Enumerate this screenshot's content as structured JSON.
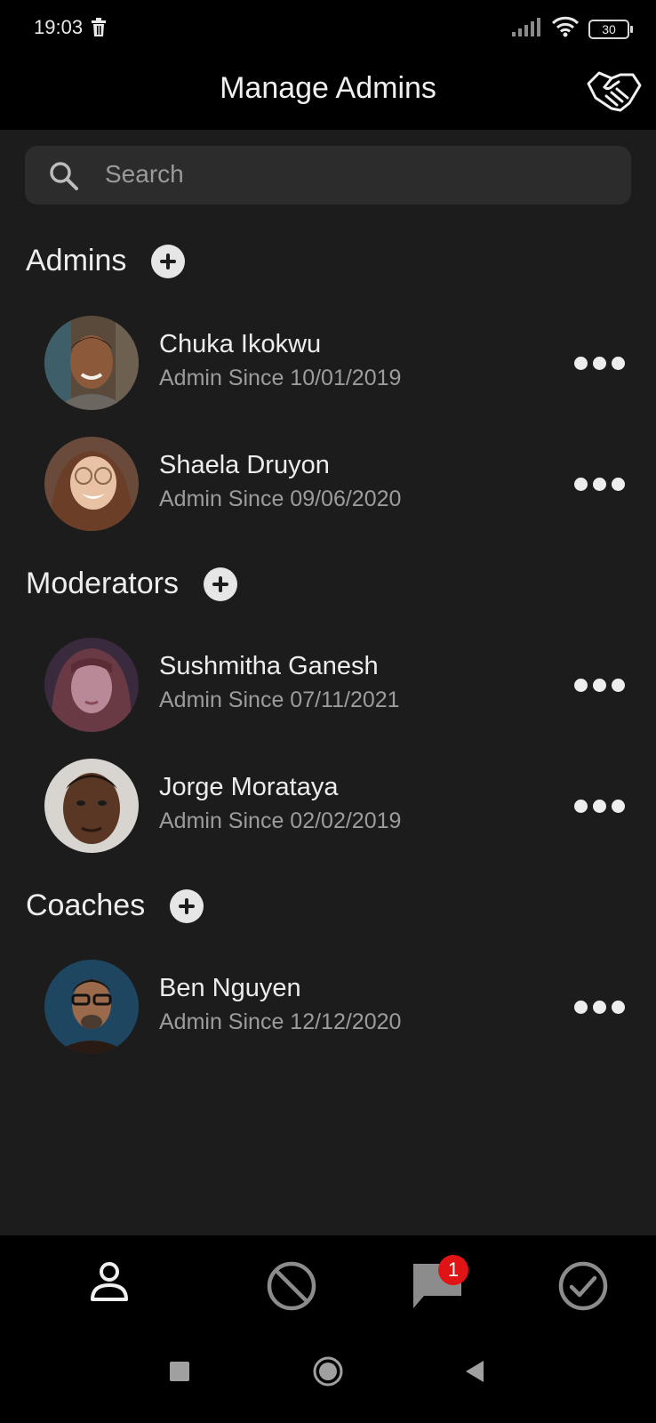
{
  "status_bar": {
    "time": "19:03",
    "battery": "30"
  },
  "app_bar": {
    "title": "Manage Admins"
  },
  "search": {
    "placeholder": "Search"
  },
  "sections": [
    {
      "title": "Admins",
      "members": [
        {
          "name": "Chuka Ikokwu",
          "since": "Admin Since 10/01/2019"
        },
        {
          "name": "Shaela Druyon",
          "since": "Admin Since 09/06/2020"
        }
      ]
    },
    {
      "title": "Moderators",
      "members": [
        {
          "name": "Sushmitha Ganesh",
          "since": "Admin Since 07/11/2021"
        },
        {
          "name": "Jorge Morataya",
          "since": "Admin Since 02/02/2019"
        }
      ]
    },
    {
      "title": "Coaches",
      "members": [
        {
          "name": "Ben Nguyen",
          "since": "Admin Since 12/12/2020"
        }
      ]
    }
  ],
  "bottom_nav": {
    "items": [
      {
        "icon": "person-icon"
      },
      {
        "icon": "block-icon"
      },
      {
        "icon": "chat-icon",
        "badge": "1"
      },
      {
        "icon": "check-circle-icon"
      }
    ]
  },
  "colors": {
    "background": "#1c1c1c",
    "bars": "#000000",
    "badge": "#e01414"
  }
}
